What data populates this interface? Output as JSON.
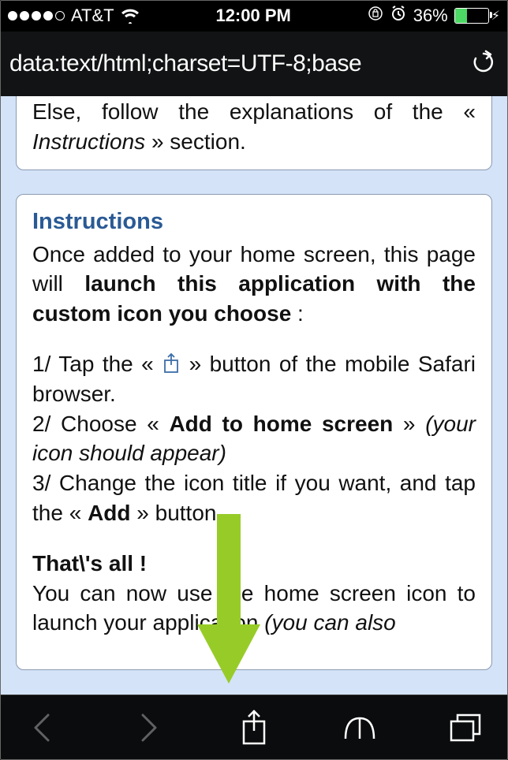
{
  "status": {
    "carrier": "AT&T",
    "time": "12:00 PM",
    "battery_pct": "36%"
  },
  "addr": {
    "url": "data:text/html;charset=UTF-8;base"
  },
  "card1": {
    "line1a": "Else, follow the explanations of the «",
    "line1b": "Instructions",
    "line1c": " » section."
  },
  "card2": {
    "heading": "Instructions",
    "p1a": "Once added to your home screen, this page will ",
    "p1b": "launch this application with the custom icon you choose",
    "p1c": " :",
    "s1a": "1/ Tap the « ",
    "s1b": " » button of the mobile Safari browser.",
    "s2a": "2/ Choose « ",
    "s2b": "Add to home screen",
    "s2c": " » ",
    "s2d": "(your icon should appear)",
    "s3a": "3/ Change the icon title if you want, and tap the « ",
    "s3b": "Add",
    "s3c": " » button",
    "p2a": "That\\'s all !",
    "p2b": "You can now use the home screen icon to launch your application ",
    "p2c": "(you can also"
  }
}
